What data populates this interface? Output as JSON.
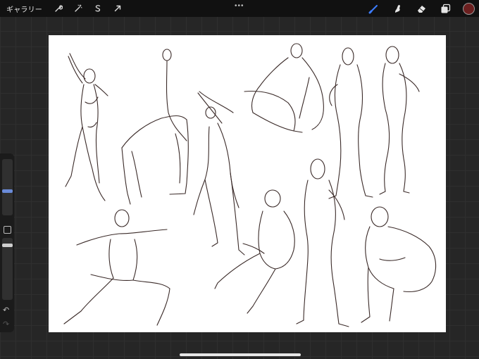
{
  "topbar": {
    "gallery_label": "ギャラリー",
    "left_tools": [
      "wrench-icon",
      "magic-wand-icon",
      "selection-icon",
      "transform-arrow-icon"
    ],
    "more_label": "•••",
    "right_tools": [
      "brush-icon",
      "smudge-icon",
      "eraser-icon",
      "layers-icon"
    ]
  },
  "colors": {
    "accent_brush": "#3d7dff",
    "current_color": "#6b1f1f",
    "ink": "#3a2a28"
  },
  "sidebar": {
    "brush_size_level": 0.25,
    "opacity_level": 0.3,
    "controls": [
      "brush-size-slider",
      "modify-button",
      "opacity-slider",
      "undo-icon",
      "redo-icon"
    ]
  }
}
